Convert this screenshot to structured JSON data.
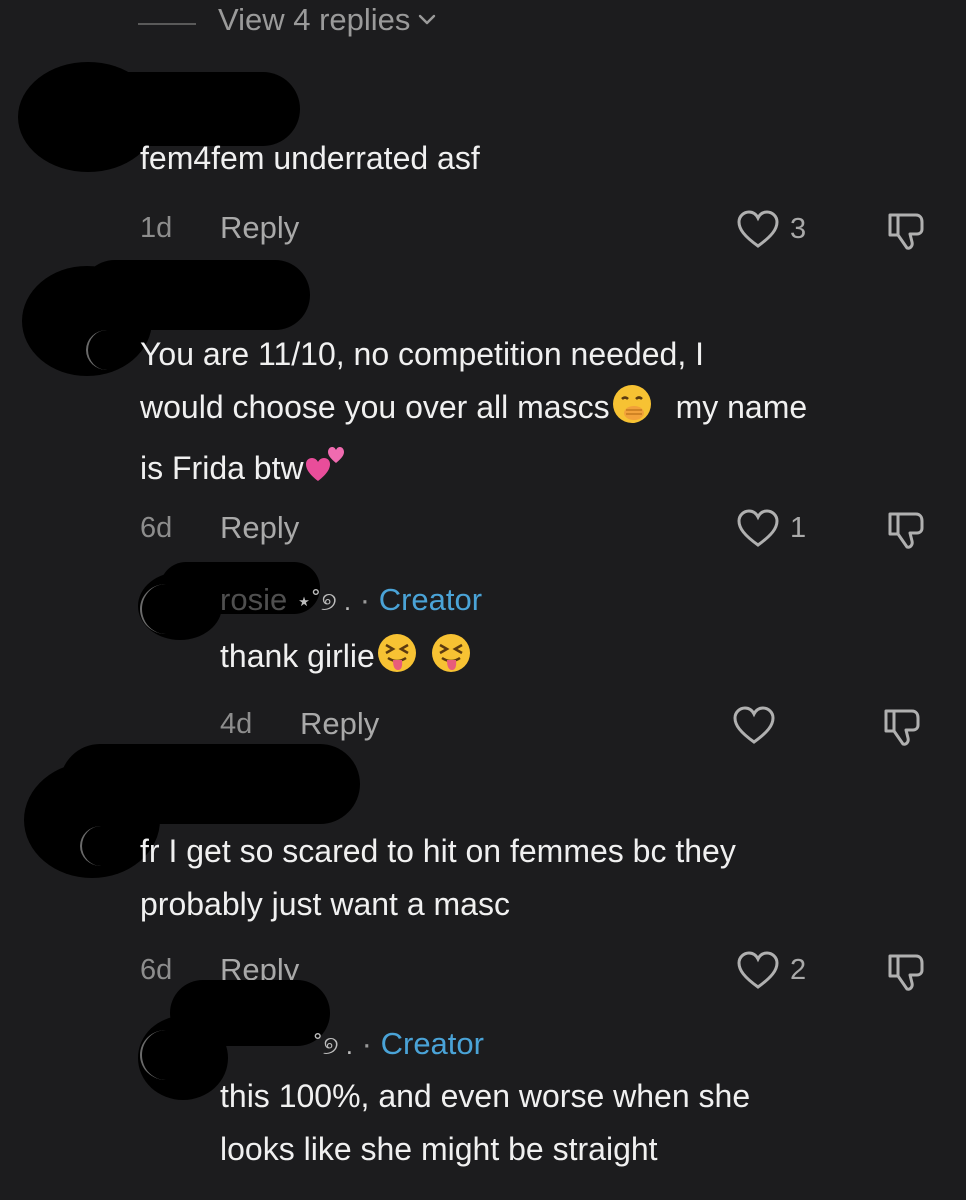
{
  "top": {
    "view_replies_label": "View 4 replies",
    "chevron_icon": "chevron-down"
  },
  "comments": [
    {
      "text_lines": [
        "fem4fem underrated asf"
      ],
      "time": "1d",
      "reply_label": "Reply",
      "likes": "3"
    },
    {
      "text_lines": [
        "You are 11/10, no competition needed, I",
        "would choose you over all mascs",
        "my name",
        "is Frida btw"
      ],
      "time": "6d",
      "reply_label": "Reply",
      "likes": "1",
      "emoji": [
        "face-with-hand-over-mouth",
        "two-hearts"
      ]
    },
    {
      "author": "rosie",
      "author_decor": "⋆˚୭ .",
      "role": "Creator",
      "separator": "·",
      "text_lines": [
        "thank girlie"
      ],
      "time": "4d",
      "reply_label": "Reply",
      "likes": "",
      "emoji": [
        "squinting-face-with-tongue",
        "squinting-face-with-tongue"
      ]
    },
    {
      "text_lines": [
        "fr I get so scared to hit on femmes bc they",
        "probably just want a masc"
      ],
      "time": "6d",
      "reply_label": "Reply",
      "likes": "2"
    },
    {
      "author_decor": "˚୭ .",
      "role": "Creator",
      "separator": "·",
      "text_lines": [
        "this 100%, and even worse when she",
        "looks like she might be straight"
      ]
    }
  ],
  "colors": {
    "background": "#1c1c1e",
    "creator": "#4aa3d7",
    "meta": "#8d8d8d"
  },
  "icons": [
    "heart-outline-icon",
    "thumbs-down-outline-icon"
  ]
}
